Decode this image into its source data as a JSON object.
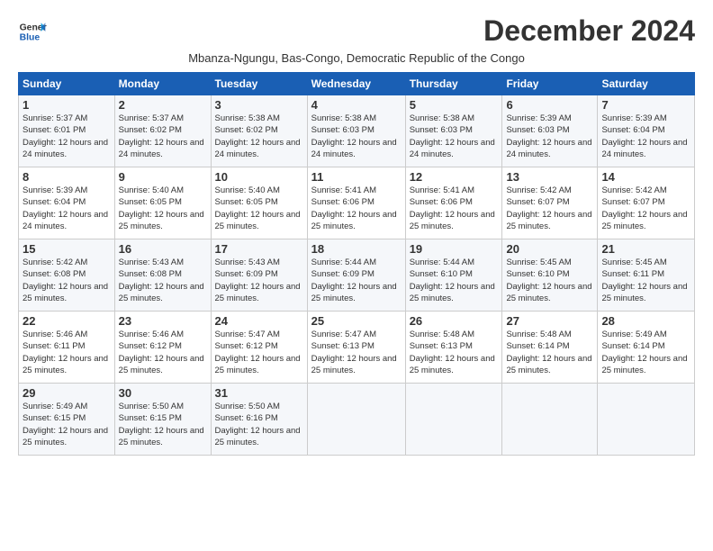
{
  "logo": {
    "line1": "General",
    "line2": "Blue"
  },
  "title": "December 2024",
  "subtitle": "Mbanza-Ngungu, Bas-Congo, Democratic Republic of the Congo",
  "days_header": [
    "Sunday",
    "Monday",
    "Tuesday",
    "Wednesday",
    "Thursday",
    "Friday",
    "Saturday"
  ],
  "weeks": [
    [
      {
        "num": "1",
        "rise": "5:37 AM",
        "set": "6:01 PM",
        "daylight": "12 hours and 24 minutes."
      },
      {
        "num": "2",
        "rise": "5:37 AM",
        "set": "6:02 PM",
        "daylight": "12 hours and 24 minutes."
      },
      {
        "num": "3",
        "rise": "5:38 AM",
        "set": "6:02 PM",
        "daylight": "12 hours and 24 minutes."
      },
      {
        "num": "4",
        "rise": "5:38 AM",
        "set": "6:03 PM",
        "daylight": "12 hours and 24 minutes."
      },
      {
        "num": "5",
        "rise": "5:38 AM",
        "set": "6:03 PM",
        "daylight": "12 hours and 24 minutes."
      },
      {
        "num": "6",
        "rise": "5:39 AM",
        "set": "6:03 PM",
        "daylight": "12 hours and 24 minutes."
      },
      {
        "num": "7",
        "rise": "5:39 AM",
        "set": "6:04 PM",
        "daylight": "12 hours and 24 minutes."
      }
    ],
    [
      {
        "num": "8",
        "rise": "5:39 AM",
        "set": "6:04 PM",
        "daylight": "12 hours and 24 minutes."
      },
      {
        "num": "9",
        "rise": "5:40 AM",
        "set": "6:05 PM",
        "daylight": "12 hours and 25 minutes."
      },
      {
        "num": "10",
        "rise": "5:40 AM",
        "set": "6:05 PM",
        "daylight": "12 hours and 25 minutes."
      },
      {
        "num": "11",
        "rise": "5:41 AM",
        "set": "6:06 PM",
        "daylight": "12 hours and 25 minutes."
      },
      {
        "num": "12",
        "rise": "5:41 AM",
        "set": "6:06 PM",
        "daylight": "12 hours and 25 minutes."
      },
      {
        "num": "13",
        "rise": "5:42 AM",
        "set": "6:07 PM",
        "daylight": "12 hours and 25 minutes."
      },
      {
        "num": "14",
        "rise": "5:42 AM",
        "set": "6:07 PM",
        "daylight": "12 hours and 25 minutes."
      }
    ],
    [
      {
        "num": "15",
        "rise": "5:42 AM",
        "set": "6:08 PM",
        "daylight": "12 hours and 25 minutes."
      },
      {
        "num": "16",
        "rise": "5:43 AM",
        "set": "6:08 PM",
        "daylight": "12 hours and 25 minutes."
      },
      {
        "num": "17",
        "rise": "5:43 AM",
        "set": "6:09 PM",
        "daylight": "12 hours and 25 minutes."
      },
      {
        "num": "18",
        "rise": "5:44 AM",
        "set": "6:09 PM",
        "daylight": "12 hours and 25 minutes."
      },
      {
        "num": "19",
        "rise": "5:44 AM",
        "set": "6:10 PM",
        "daylight": "12 hours and 25 minutes."
      },
      {
        "num": "20",
        "rise": "5:45 AM",
        "set": "6:10 PM",
        "daylight": "12 hours and 25 minutes."
      },
      {
        "num": "21",
        "rise": "5:45 AM",
        "set": "6:11 PM",
        "daylight": "12 hours and 25 minutes."
      }
    ],
    [
      {
        "num": "22",
        "rise": "5:46 AM",
        "set": "6:11 PM",
        "daylight": "12 hours and 25 minutes."
      },
      {
        "num": "23",
        "rise": "5:46 AM",
        "set": "6:12 PM",
        "daylight": "12 hours and 25 minutes."
      },
      {
        "num": "24",
        "rise": "5:47 AM",
        "set": "6:12 PM",
        "daylight": "12 hours and 25 minutes."
      },
      {
        "num": "25",
        "rise": "5:47 AM",
        "set": "6:13 PM",
        "daylight": "12 hours and 25 minutes."
      },
      {
        "num": "26",
        "rise": "5:48 AM",
        "set": "6:13 PM",
        "daylight": "12 hours and 25 minutes."
      },
      {
        "num": "27",
        "rise": "5:48 AM",
        "set": "6:14 PM",
        "daylight": "12 hours and 25 minutes."
      },
      {
        "num": "28",
        "rise": "5:49 AM",
        "set": "6:14 PM",
        "daylight": "12 hours and 25 minutes."
      }
    ],
    [
      {
        "num": "29",
        "rise": "5:49 AM",
        "set": "6:15 PM",
        "daylight": "12 hours and 25 minutes."
      },
      {
        "num": "30",
        "rise": "5:50 AM",
        "set": "6:15 PM",
        "daylight": "12 hours and 25 minutes."
      },
      {
        "num": "31",
        "rise": "5:50 AM",
        "set": "6:16 PM",
        "daylight": "12 hours and 25 minutes."
      },
      null,
      null,
      null,
      null
    ]
  ]
}
